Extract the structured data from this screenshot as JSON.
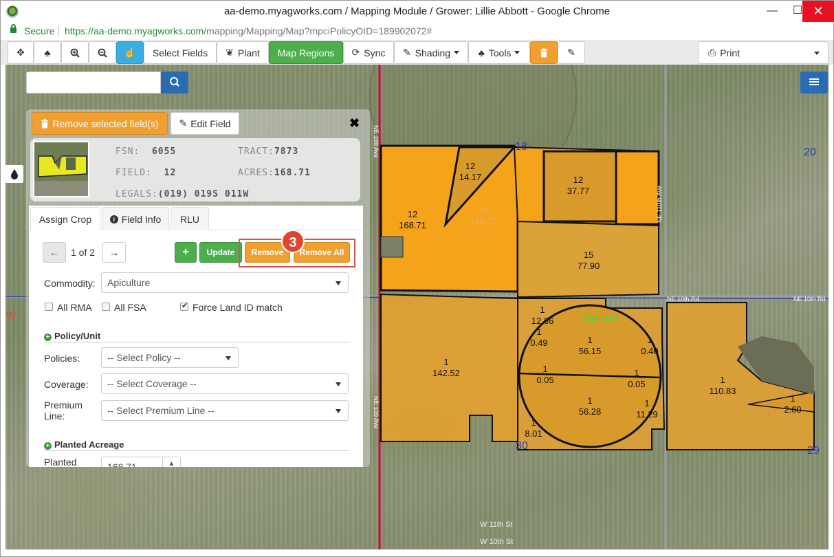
{
  "window": {
    "title": "aa-demo.myagworks.com / Mapping Module / Grower: Lillie Abbott - Google Chrome",
    "minimize": "—",
    "maximize": "☐",
    "close": "✕"
  },
  "address": {
    "secure": "Secure",
    "url_host": "https://aa-demo.myagworks.com",
    "url_rest": "/mapping/Mapping/Map?mpciPolicyOID=189902072#"
  },
  "toolbar": {
    "select_fields": "Select Fields",
    "plant": "Plant",
    "map_regions": "Map Regions",
    "sync": "Sync",
    "shading": "Shading",
    "tools": "Tools",
    "print": "Print"
  },
  "panel": {
    "remove_selected": "Remove selected field(s)",
    "edit_field": "Edit Field",
    "close": "✖",
    "fsn_label": "FSN:",
    "fsn_value": "6055",
    "tract_label": "TRACT:",
    "tract_value": "7873",
    "field_label": "FIELD:",
    "field_value": "12",
    "acres_label": "ACRES:",
    "acres_value": "168.71",
    "legals_label": "LEGALS:",
    "legals_value": "(019) 019S 011W",
    "tabs": [
      "Assign Crop",
      "Field Info",
      "RLU"
    ],
    "pager": "1 of 2",
    "add": "+",
    "update": "Update",
    "remove": "Remove",
    "remove_all": "Remove All",
    "commodity_label": "Commodity:",
    "commodity_value": "Apiculture",
    "all_rma": "All RMA",
    "all_fsa": "All FSA",
    "force_land": "Force Land ID match",
    "policy_unit": "Policy/Unit",
    "policies_label": "Policies:",
    "policies_value": "-- Select Policy --",
    "coverage_label": "Coverage:",
    "coverage_value": "-- Select Coverage --",
    "premium_label_1": "Premium",
    "premium_label_2": "Line:",
    "premium_value": "-- Select Premium Line --",
    "planted_acreage": "Planted Acreage",
    "planted_label": "Planted",
    "planted_value": "168.71"
  },
  "annotation": {
    "step": "3"
  },
  "map": {
    "section_labels": [
      "18",
      "20",
      "24",
      "30",
      "29"
    ],
    "roads": [
      "NE 100 Ave",
      "NE 110th Ave",
      "NE 10th Rd",
      "NE 10th Rd",
      "NE 100 Ave",
      "W 11th St",
      "W 10th St"
    ],
    "town": "Barton",
    "edge_label": "W",
    "fields": [
      {
        "num": "12",
        "acres": "168.71"
      },
      {
        "num": "12",
        "acres": "14.17"
      },
      {
        "num": "12",
        "acres": "37.77"
      },
      {
        "num": "12",
        "acres": "168.71"
      },
      {
        "num": "15",
        "acres": "77.90"
      },
      {
        "num": "1",
        "acres": "142.52"
      },
      {
        "num": "1",
        "acres": "12.66"
      },
      {
        "num": "1",
        "acres": "0.49"
      },
      {
        "num": "1",
        "acres": "56.15"
      },
      {
        "num": "1",
        "acres": "0.40"
      },
      {
        "num": "1",
        "acres": "0.05"
      },
      {
        "num": "1",
        "acres": "0.05"
      },
      {
        "num": "1",
        "acres": "56.28"
      },
      {
        "num": "1",
        "acres": "11.29"
      },
      {
        "num": "1",
        "acres": "8.01"
      },
      {
        "num": "1",
        "acres": "110.83"
      },
      {
        "num": "1",
        "acres": "2.60"
      }
    ],
    "colors": {
      "selected": "#f5a31b",
      "field": "#e0a033",
      "road": "#2c3e9e",
      "boundary": "#c8102e"
    }
  }
}
